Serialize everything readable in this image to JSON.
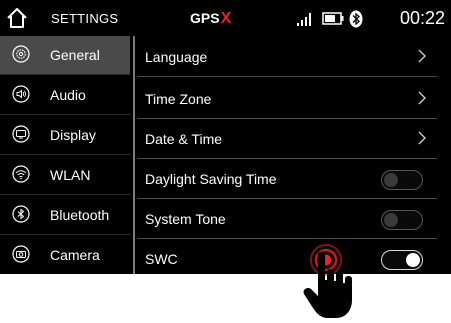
{
  "status": {
    "title": "SETTINGS",
    "gps_label": "GPS",
    "gps_state": "X",
    "time": "00:22",
    "icons": [
      "home-icon",
      "signal-icon",
      "battery-icon",
      "bluetooth-icon"
    ]
  },
  "sidebar": {
    "items": [
      {
        "label": "General",
        "icon": "gear-icon",
        "active": true
      },
      {
        "label": "Audio",
        "icon": "speaker-icon",
        "active": false
      },
      {
        "label": "Display",
        "icon": "monitor-icon",
        "active": false
      },
      {
        "label": "WLAN",
        "icon": "wifi-icon",
        "active": false
      },
      {
        "label": "Bluetooth",
        "icon": "bluetooth-icon",
        "active": false
      },
      {
        "label": "Camera",
        "icon": "camera-icon",
        "active": false
      }
    ]
  },
  "settings": {
    "rows": [
      {
        "label": "Language",
        "control": "chevron"
      },
      {
        "label": "Time Zone",
        "control": "chevron"
      },
      {
        "label": "Date & Time",
        "control": "chevron"
      },
      {
        "label": "Daylight Saving Time",
        "control": "toggle",
        "on": false
      },
      {
        "label": "System Tone",
        "control": "toggle",
        "on": false
      },
      {
        "label": "SWC",
        "control": "toggle",
        "on": true
      }
    ]
  },
  "colors": {
    "background": "#000000",
    "active_item": "#4a4a4a",
    "gps_off": "#e8222a",
    "touch_indicator": "#e8222a"
  }
}
